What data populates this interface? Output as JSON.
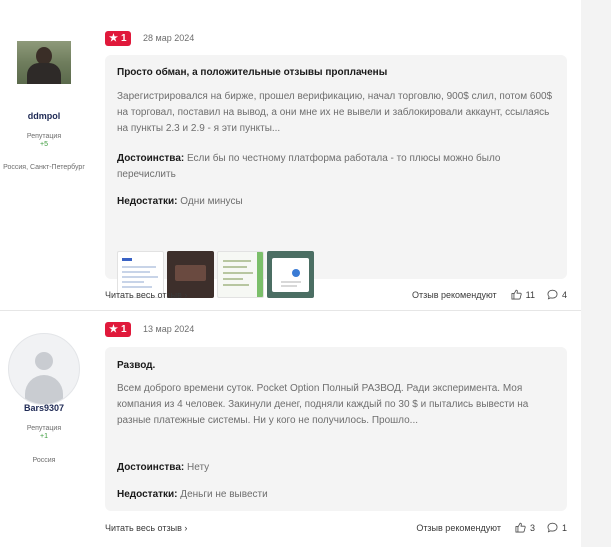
{
  "reviews": [
    {
      "username": "ddmpol",
      "reputation_label": "Репутация",
      "reputation_value": "+5",
      "location": "Россия, Санкт-Петербург",
      "rating": "1",
      "date": "28 мар 2024",
      "title": "Просто обман, а положительные отзывы проплачены",
      "text": "Зарегистрировался на бирже, прошел верификацию, начал торговлю, 900$ слил, потом 600$ на торговал, поставил на вывод, а они мне их не вывели и заблокировали аккаунт, ссылаясь на пункты 2.3 и 2.9 - я эти пункты...",
      "pros_label": "Достоинства:",
      "pros_text": "Если бы по честному платформа работала - то плюсы можно было перечислить",
      "cons_label": "Недостатки:",
      "cons_text": "Одни минусы",
      "read_more": "Читать весь отзыв",
      "recommend_label": "Отзыв рекомендуют",
      "likes": "11",
      "comments": "4"
    },
    {
      "username": "Bars9307",
      "reputation_label": "Репутация",
      "reputation_value": "+1",
      "location": "Россия",
      "rating": "1",
      "date": "13 мар 2024",
      "title": "Развод.",
      "text": "Всем доброго времени суток. Pocket Option Полный РАЗВОД. Ради эксперимента. Моя компания из 4 человек. Закинули денег, подняли каждый по 30 $ и пытались вывести на разные платежные системы. Ни у кого не получилось. Прошло...",
      "pros_label": "Достоинства:",
      "pros_text": "Нету",
      "cons_label": "Недостатки:",
      "cons_text": "Деньги не вывести",
      "read_more": "Читать весь отзыв",
      "recommend_label": "Отзыв рекомендуют",
      "likes": "3",
      "comments": "1"
    }
  ],
  "icons": {
    "rating": "star-icon",
    "chevron": "chevron-right-icon",
    "likes": "thumbs-up-icon",
    "comments": "comment-icon"
  },
  "colors": {
    "rating_badge": "#e0193b",
    "reputation_positive": "#3a9a3a",
    "card_background": "#f4f4f4"
  }
}
